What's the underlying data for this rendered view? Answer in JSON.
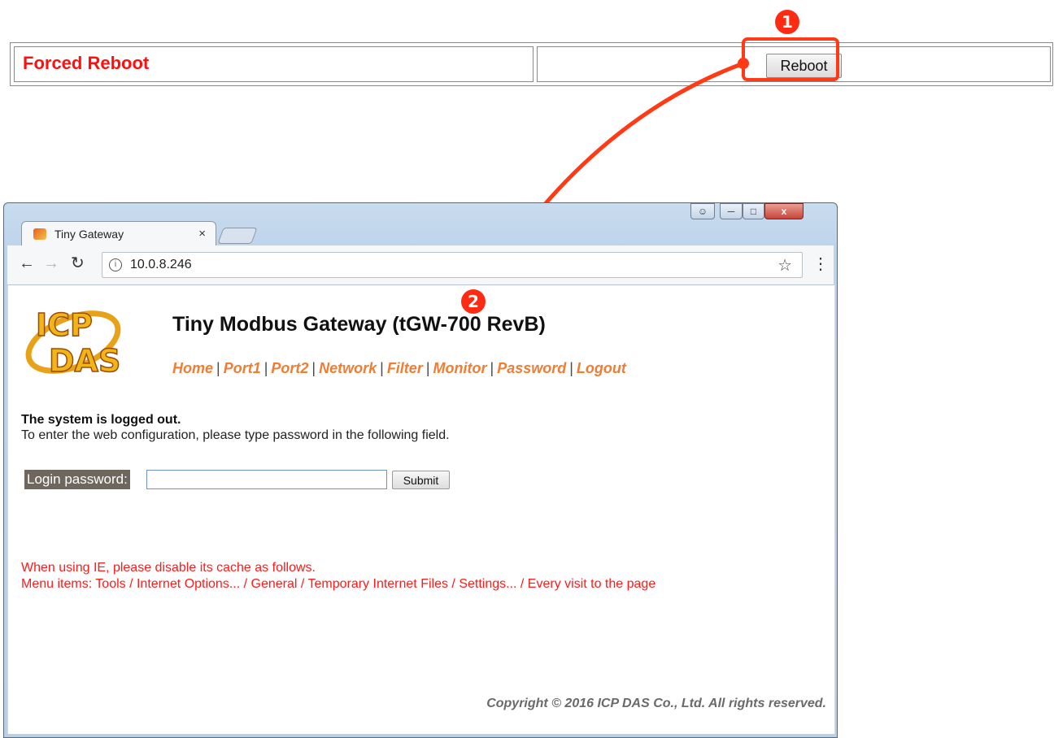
{
  "top_table": {
    "title": "Forced Reboot",
    "reboot_button": "Reboot"
  },
  "annotations": {
    "marker_1": "❶",
    "marker_2": "❷",
    "color": "#ff3a15"
  },
  "browser": {
    "tab_title": "Tiny Gateway",
    "tab_close": "×",
    "address": "10.0.8.246",
    "window_buttons": {
      "close": "x"
    }
  },
  "page": {
    "title": "Tiny Modbus Gateway (tGW-700 RevB)",
    "nav": [
      "Home",
      "Port1",
      "Port2",
      "Network",
      "Filter",
      "Monitor",
      "Password",
      "Logout"
    ],
    "nav_separator": "|",
    "logged_out": "The system is logged out.",
    "instruction": "To enter the web configuration, please type password in the following field.",
    "password_label": "Login password:",
    "password_value": "",
    "submit": "Submit",
    "ie_note_line1": "When using IE, please disable its cache as follows.",
    "ie_note_line2": "Menu items: Tools / Internet Options... / General / Temporary Internet Files / Settings... / Every visit to the page",
    "copyright": "Copyright © 2016 ICP DAS Co., Ltd. All rights reserved.",
    "logo_alt": "ICP DAS"
  },
  "colors": {
    "title_red": "#ff1010",
    "nav_orange": "#ef7d35",
    "note_red": "#ff1a1a"
  }
}
